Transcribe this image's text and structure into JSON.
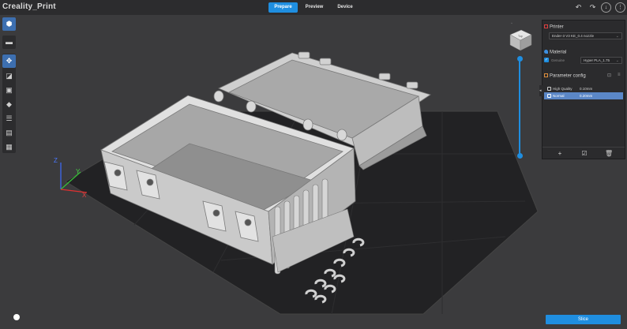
{
  "app": {
    "title": "Creality_Print"
  },
  "tabs": [
    {
      "label": "Prepare",
      "active": true
    },
    {
      "label": "Preview",
      "active": false
    },
    {
      "label": "Device",
      "active": false
    }
  ],
  "topbar_icons": [
    "undo-icon",
    "redo-icon",
    "download-icon",
    "menu-icon"
  ],
  "toolbar": {
    "items": [
      "add-model-icon",
      "open-folder-icon",
      "move-icon",
      "scale-icon",
      "rotate-icon",
      "paint-icon",
      "list-icon",
      "support-icon",
      "arrange-icon"
    ]
  },
  "panel": {
    "printer": {
      "title": "Printer",
      "selected": "Ender-3 V3 KE_0.4 nozzle"
    },
    "material": {
      "title": "Material",
      "slot_label": "Genuine",
      "selected": "Hyper PLA_1.75"
    },
    "parameter": {
      "title": "Parameter config",
      "rows": [
        {
          "name": "High Quality",
          "value": "0.10mm",
          "selected": false
        },
        {
          "name": "Normal",
          "value": "0.20mm",
          "selected": true
        }
      ]
    }
  },
  "view_cube": {
    "face_label": "Top"
  },
  "slice": {
    "label": "Slice"
  },
  "colors": {
    "accent": "#1f8ee0",
    "background": "#3b3b3d",
    "bed": "#1f1f21",
    "model": "#c8c8c8",
    "panel": "#2b2b2d",
    "selected_row": "#5b87c7"
  }
}
